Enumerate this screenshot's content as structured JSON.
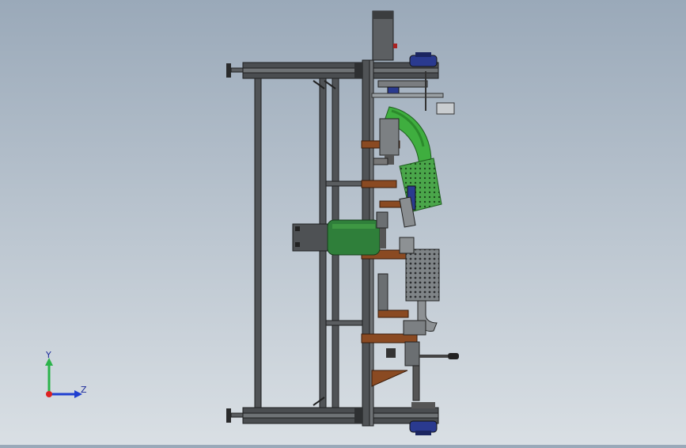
{
  "viewport": {
    "background_top": "#9aa9b9",
    "background_bottom": "#d9dfe4"
  },
  "model": {
    "frame_color": "#3f4244",
    "bracket_color": "#8a4a22",
    "pipe_green": "#3fae3f",
    "motor_green": "#2f7f3a",
    "part_blue": "#2a3a8f"
  },
  "triad": {
    "y_label": "Y",
    "z_label": "Z",
    "y_color": "#2bb34a",
    "z_color": "#1f3fd0",
    "origin_color": "#d22"
  }
}
